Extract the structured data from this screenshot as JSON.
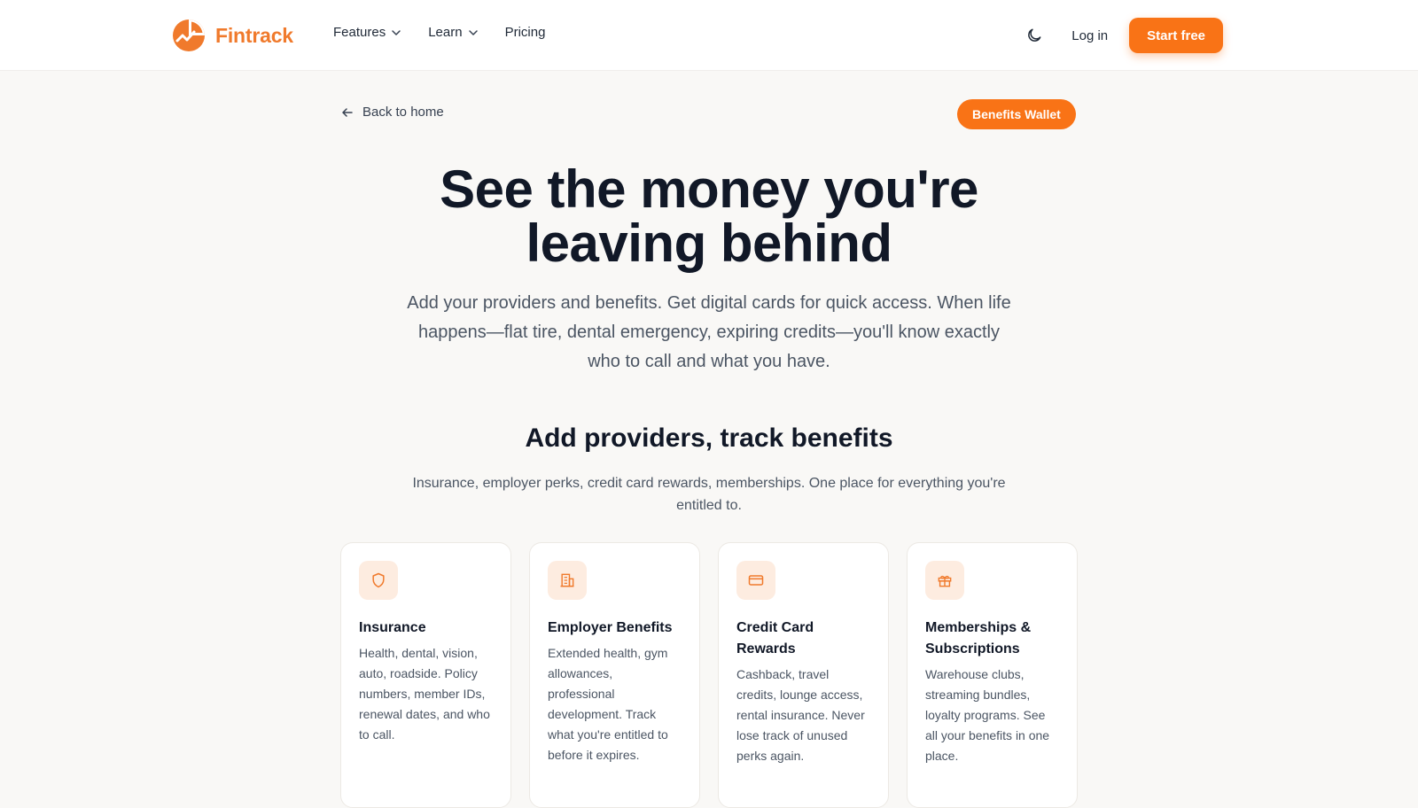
{
  "brand": {
    "name": "Fintrack",
    "accent": "#f97316",
    "logo_icon": "pie-chart-logo-icon"
  },
  "nav": {
    "links": [
      {
        "label": "Features",
        "has_dropdown": true
      },
      {
        "label": "Learn",
        "has_dropdown": true
      },
      {
        "label": "Pricing",
        "has_dropdown": false
      }
    ],
    "theme_toggle_icon": "moon-icon",
    "login_label": "Log in",
    "cta_label": "Start free"
  },
  "page": {
    "back_label": "Back to home",
    "badge_label": "Benefits Wallet",
    "hero_title": "See the money you're leaving behind",
    "hero_subtitle": "Add your providers and benefits. Get digital cards for quick access. When life happens—flat tire, dental emergency, expiring credits—you'll know exactly who to call and what you have.",
    "section_title": "Add providers, track benefits",
    "section_subtitle": "Insurance, employer perks, credit card rewards, memberships. One place for everything you're entitled to."
  },
  "cards": [
    {
      "icon": "shield-icon",
      "title": "Insurance",
      "text": "Health, dental, vision, auto, roadside. Policy numbers, member IDs, renewal dates, and who to call."
    },
    {
      "icon": "building-icon",
      "title": "Employer Benefits",
      "text": "Extended health, gym allowances, professional development. Track what you're entitled to before it expires."
    },
    {
      "icon": "credit-card-icon",
      "title": "Credit Card Rewards",
      "text": "Cashback, travel credits, lounge access, rental insurance. Never lose track of unused perks again."
    },
    {
      "icon": "gift-icon",
      "title": "Memberships & Subscriptions",
      "text": "Warehouse clubs, streaming bundles, loyalty programs. See all your benefits in one place."
    }
  ]
}
